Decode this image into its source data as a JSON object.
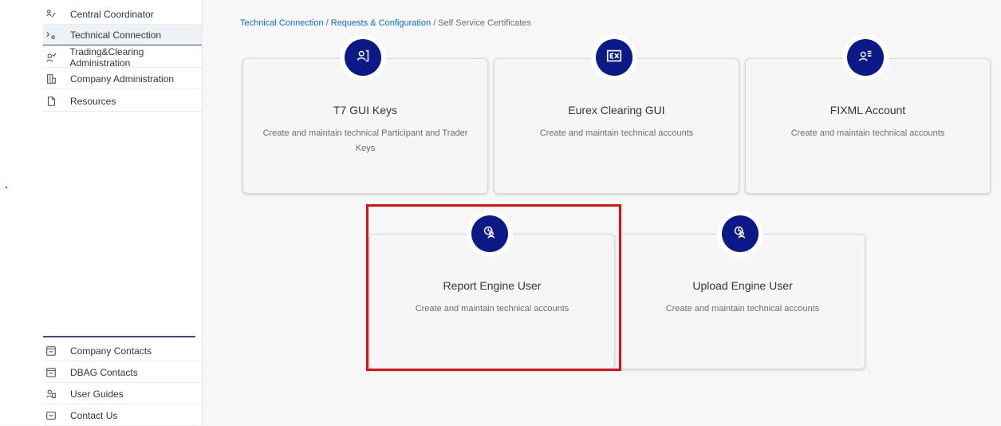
{
  "sidebar": {
    "top_items": [
      {
        "label": "Central Coordinator",
        "icon": "coordinator-icon"
      },
      {
        "label": "Technical Connection",
        "icon": "technical-connection-icon",
        "active": true
      },
      {
        "label": "Trading&Clearing Administration",
        "icon": "user-check-icon"
      },
      {
        "label": "Company Administration",
        "icon": "building-icon"
      },
      {
        "label": "Resources",
        "icon": "document-icon"
      }
    ],
    "bottom_items": [
      {
        "label": "Company Contacts",
        "icon": "contact-card-icon"
      },
      {
        "label": "DBAG Contacts",
        "icon": "contact-card-icon"
      },
      {
        "label": "User Guides",
        "icon": "user-guide-icon"
      },
      {
        "label": "Contact Us",
        "icon": "mail-icon"
      }
    ]
  },
  "breadcrumb": {
    "link1": "Technical Connection",
    "sep1": " / ",
    "link2": "Requests & Configuration",
    "sep2": " / ",
    "current": "Self Service Certificates"
  },
  "cards": [
    {
      "title": "T7 GUI Keys",
      "description": "Create and maintain technical Participant and Trader Keys",
      "icon": "key-user-icon"
    },
    {
      "title": "Eurex Clearing GUI",
      "description": "Create and maintain technical accounts",
      "icon": "eurex-ex-icon"
    },
    {
      "title": "FIXML Account",
      "description": "Create and maintain technical accounts",
      "icon": "user-list-icon"
    },
    {
      "title": "Report Engine User",
      "description": "Create and maintain technical accounts",
      "icon": "user-clock-icon"
    },
    {
      "title": "Upload Engine User",
      "description": "Create and maintain technical accounts",
      "icon": "user-clock-icon"
    }
  ],
  "colors": {
    "accent": "#0b1a87",
    "link": "#0a6ed1",
    "highlight": "#e01010"
  }
}
